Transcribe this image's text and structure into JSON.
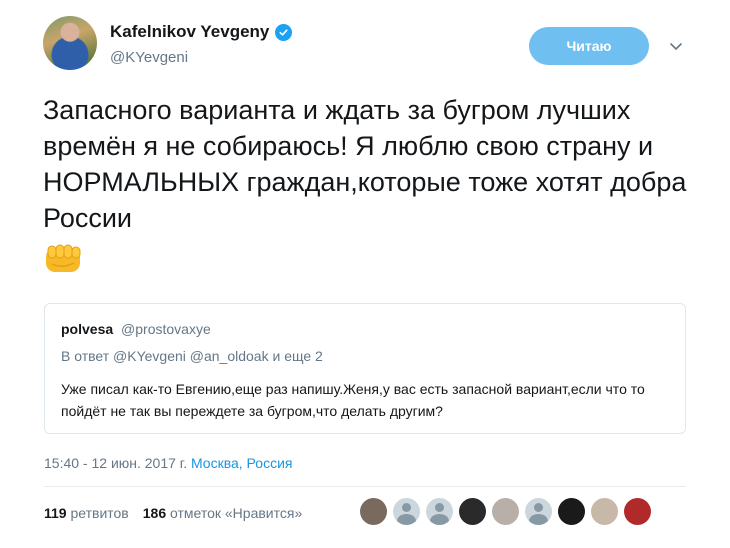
{
  "author": {
    "name": "Kafelnikov Yevgeny",
    "handle": "@KYevgeni",
    "verified_icon": "verified-badge-icon",
    "follow_label": "Читаю",
    "accent_color": "#1da1f2"
  },
  "tweet": {
    "text": "Запасного варианта и ждать за бугром лучших времён я не собираюсь! Я люблю свою страну и НОРМАЛЬНЫХ граждан,которые тоже хотят добра России",
    "emoji_icon": "fist-emoji-icon"
  },
  "quoted": {
    "name": "polvesa",
    "handle": "@prostovaxye",
    "reply_to": "В ответ @KYevgeni @an_oldoak и еще 2",
    "text": "Уже писал как-то Евгению,еще раз напишу.Женя,у вас есть запасной вариант,если что то пойдёт не так вы переждете за бугром,что делать другим?"
  },
  "meta": {
    "datetime": "15:40 - 12 июн. 2017 г.",
    "location": "Москва, Россия"
  },
  "stats": {
    "retweets_count": "119",
    "retweets_label": "ретвитов",
    "likes_count": "186",
    "likes_label": "отметок «Нравится»"
  },
  "likers": [
    {
      "name": "liker-avatar-1",
      "color": "#7a6a5e"
    },
    {
      "name": "liker-avatar-2",
      "color": "#ccd6dd"
    },
    {
      "name": "liker-avatar-3",
      "color": "#ccd6dd"
    },
    {
      "name": "liker-avatar-4",
      "color": "#2a2a2a"
    },
    {
      "name": "liker-avatar-5",
      "color": "#b8b0a8"
    },
    {
      "name": "liker-avatar-6",
      "color": "#ccd6dd"
    },
    {
      "name": "liker-avatar-7",
      "color": "#1a1a1a"
    },
    {
      "name": "liker-avatar-8",
      "color": "#c8b8a8"
    },
    {
      "name": "liker-avatar-9",
      "color": "#b02a2a"
    }
  ]
}
